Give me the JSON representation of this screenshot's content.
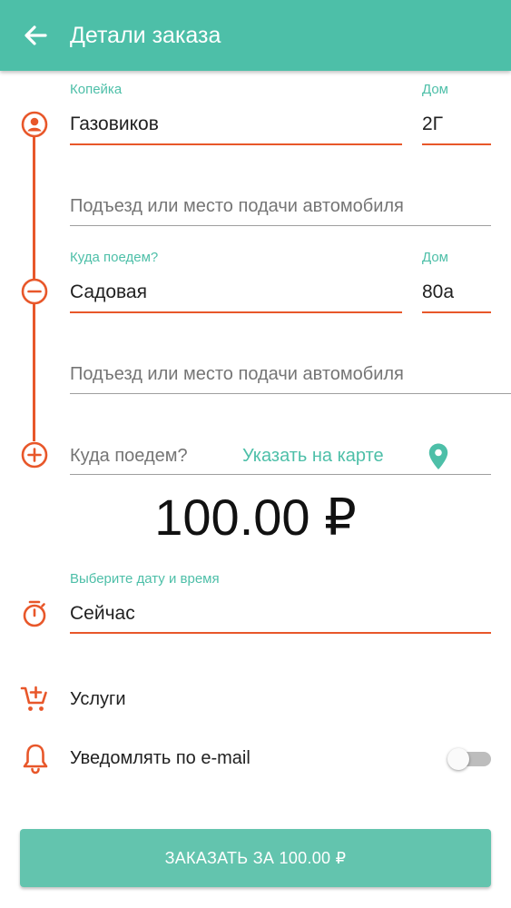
{
  "header": {
    "title": "Детали заказа",
    "back_icon": "arrow-left-icon"
  },
  "colors": {
    "primary": "#4DBFA8",
    "accent": "#E8572A",
    "button": "#63C4AE"
  },
  "origin": {
    "street_label": "Копейка",
    "street_value": "Газовиков",
    "house_label": "Дом",
    "house_value": "2Г",
    "entrance_placeholder": "Подъезд или место подачи автомобиля"
  },
  "stop": {
    "street_label": "Куда поедем?",
    "street_value": "Садовая",
    "house_label": "Дом",
    "house_value": "80а",
    "entrance_placeholder": "Подъезд или место подачи автомобиля"
  },
  "add_destination": {
    "placeholder": "Куда поедем?",
    "map_link": "Указать на карте"
  },
  "price": "100.00 ₽",
  "datetime": {
    "label": "Выберите дату и время",
    "value": "Сейчас"
  },
  "services": {
    "label": "Услуги"
  },
  "notify": {
    "label": "Уведомлять по e-mail",
    "enabled": false
  },
  "order_button": {
    "label": "ЗАКАЗАТЬ ЗА 100.00 ₽"
  }
}
